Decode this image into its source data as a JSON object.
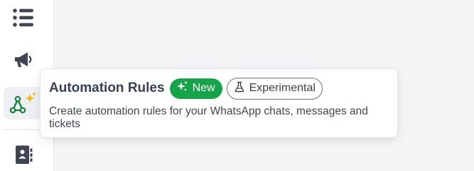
{
  "sidebar": {
    "items": [
      {
        "icon": "list-icon"
      },
      {
        "icon": "megaphone-icon"
      },
      {
        "icon": "automation-icon",
        "active": true
      },
      {
        "icon": "contacts-book-icon"
      }
    ]
  },
  "tooltip": {
    "title": "Automation Rules",
    "badge_new": "New",
    "badge_experimental": "Experimental",
    "description": "Create automation rules for your WhatsApp chats, messages and tickets"
  },
  "colors": {
    "accent_green": "#16a34a",
    "sparkle_yellow": "#f5b400",
    "text_dark": "#374151",
    "icon_dark": "#3f4552"
  }
}
